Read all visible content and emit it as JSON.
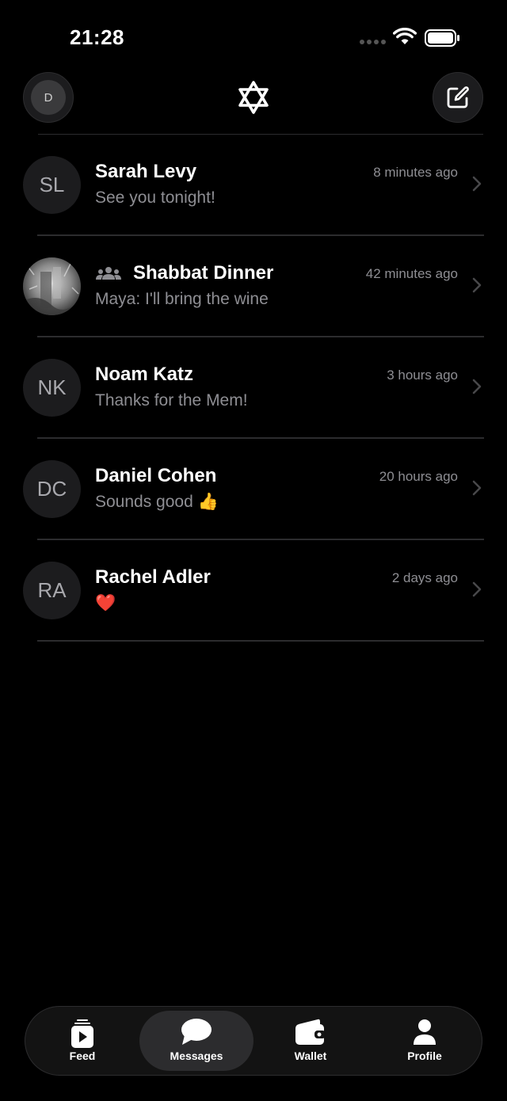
{
  "status_bar": {
    "time": "21:28",
    "icons": [
      "signal-dots-icon",
      "wifi-icon",
      "battery-icon"
    ]
  },
  "header": {
    "avatar_initial": "D",
    "logo_icon": "star-of-david-icon",
    "compose_icon": "compose-icon"
  },
  "conversations": [
    {
      "initials": "SL",
      "name": "Sarah Levy",
      "time": "8 minutes ago",
      "preview": "See you tonight!",
      "is_group": false
    },
    {
      "initials": "",
      "name": "Shabbat Dinner",
      "time": "42 minutes ago",
      "preview": "Maya: I'll bring the wine",
      "is_group": true,
      "group_icon": "group-icon",
      "avatar_type": "photo"
    },
    {
      "initials": "NK",
      "name": "Noam Katz",
      "time": "3 hours ago",
      "preview": "Thanks for the Mem!",
      "is_group": false
    },
    {
      "initials": "DC",
      "name": "Daniel Cohen",
      "time": "20 hours ago",
      "preview": "Sounds good 👍",
      "is_group": false
    },
    {
      "initials": "RA",
      "name": "Rachel Adler",
      "time": "2 days ago",
      "preview": "❤️",
      "is_group": false
    }
  ],
  "tabs": [
    {
      "label": "Feed",
      "icon": "feed-icon",
      "active": false
    },
    {
      "label": "Messages",
      "icon": "messages-icon",
      "active": true
    },
    {
      "label": "Wallet",
      "icon": "wallet-icon",
      "active": false
    },
    {
      "label": "Profile",
      "icon": "profile-icon",
      "active": false
    }
  ],
  "colors": {
    "background": "#000000",
    "surface": "#1c1c1e",
    "divider": "#2c2c2e",
    "secondary_text": "#8e8e93",
    "active_tab": "#2c2c2e"
  }
}
